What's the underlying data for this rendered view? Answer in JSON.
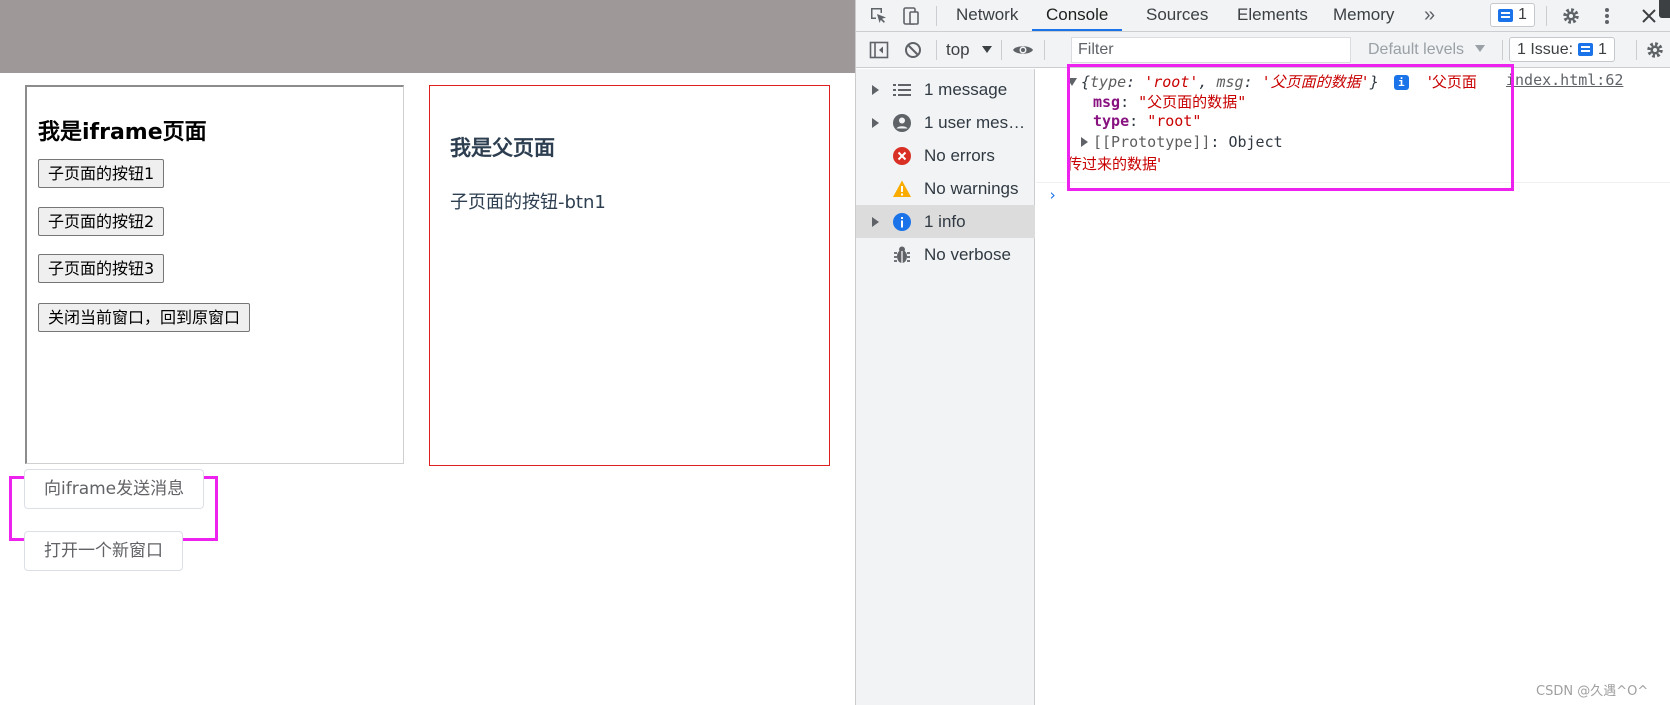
{
  "page": {
    "iframe": {
      "title": "我是iframe页面",
      "buttons": [
        "子页面的按钮1",
        "子页面的按钮2",
        "子页面的按钮3",
        "关闭当前窗口，回到原窗口"
      ]
    },
    "parent": {
      "title": "我是父页面",
      "message": "子页面的按钮-btn1"
    },
    "send_button": "向iframe发送消息",
    "open_button": "打开一个新窗口"
  },
  "devtools": {
    "tabs": [
      "Network",
      "Console",
      "Sources",
      "Elements",
      "Memory"
    ],
    "active_tab": "Console",
    "more_tabs": "»",
    "messages_badge": "1",
    "toolbar": {
      "context": "top",
      "filter_placeholder": "Filter",
      "levels": "Default levels",
      "issues_label": "1 Issue:",
      "issues_count": "1"
    },
    "sidebar": [
      {
        "label": "1 message",
        "icon": "list-icon",
        "expandable": true
      },
      {
        "label": "1 user messa...",
        "icon": "user-icon",
        "expandable": true
      },
      {
        "label": "No errors",
        "icon": "error-icon",
        "expandable": false
      },
      {
        "label": "No warnings",
        "icon": "warning-icon",
        "expandable": false
      },
      {
        "label": "1 info",
        "icon": "info-icon",
        "expandable": true,
        "selected": true
      },
      {
        "label": "No verbose",
        "icon": "bug-icon",
        "expandable": false
      }
    ],
    "console": {
      "preview_open": "{",
      "k_type": "type",
      "v_type": "'root'",
      "comma": ",",
      "k_msg": "msg",
      "v_msg": "'父页面的数据'",
      "preview_close": "}",
      "info_glyph": "i",
      "log_str_1": "'父页面",
      "log_str_2": "传过来的数据'",
      "source": "index.html:62",
      "props": [
        {
          "key": "msg",
          "value": "\"父页面的数据\""
        },
        {
          "key": "type",
          "value": "\"root\""
        }
      ],
      "proto_key": "[[Prototype]]",
      "proto_value": "Object",
      "colon": ": "
    }
  },
  "watermark": "CSDN @久遇^O^",
  "colors": {
    "highlight": "#ee22ee",
    "parent_border": "#e02020",
    "accent": "#1a73e8"
  }
}
